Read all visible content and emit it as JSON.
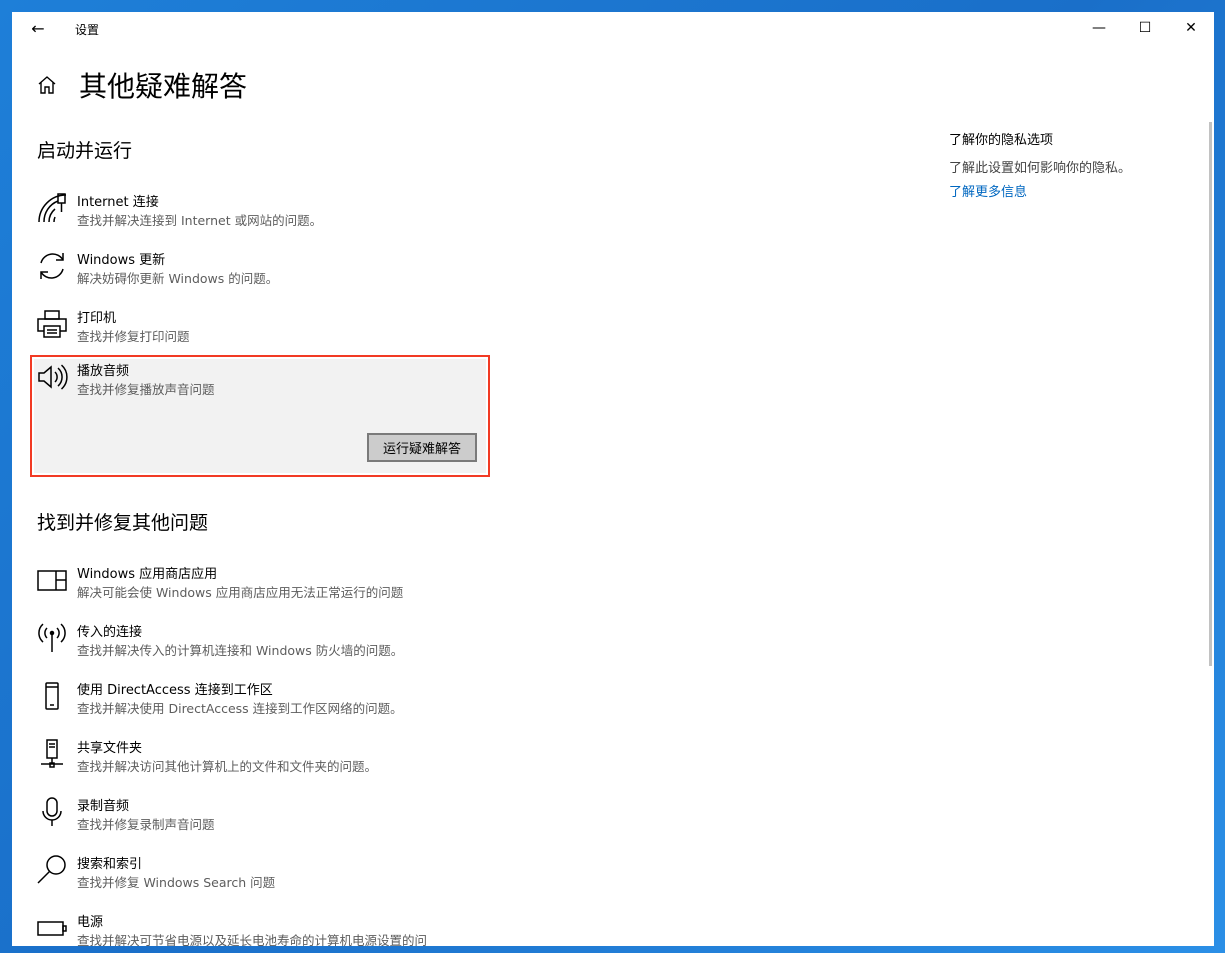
{
  "window": {
    "title": "设置",
    "back_icon": "←",
    "min_icon": "—",
    "max_icon": "☐",
    "close_icon": "✕"
  },
  "page": {
    "title": "其他疑难解答"
  },
  "sections": {
    "startup": {
      "title": "启动并运行",
      "items": [
        {
          "label": "Internet 连接",
          "desc": "查找并解决连接到 Internet 或网站的问题。",
          "icon": "wifi-icon"
        },
        {
          "label": "Windows 更新",
          "desc": "解决妨碍你更新 Windows 的问题。",
          "icon": "refresh-icon"
        },
        {
          "label": "打印机",
          "desc": "查找并修复打印问题",
          "icon": "printer-icon"
        },
        {
          "label": "播放音频",
          "desc": "查找并修复播放声音问题",
          "icon": "speaker-icon",
          "button": "运行疑难解答"
        }
      ]
    },
    "other": {
      "title": "找到并修复其他问题",
      "items": [
        {
          "label": "Windows 应用商店应用",
          "desc": "解决可能会使 Windows 应用商店应用无法正常运行的问题",
          "icon": "app-window-icon"
        },
        {
          "label": "传入的连接",
          "desc": "查找并解决传入的计算机连接和 Windows 防火墙的问题。",
          "icon": "antenna-icon"
        },
        {
          "label": "使用 DirectAccess 连接到工作区",
          "desc": "查找并解决使用 DirectAccess 连接到工作区网络的问题。",
          "icon": "phone-icon"
        },
        {
          "label": "共享文件夹",
          "desc": "查找并解决访问其他计算机上的文件和文件夹的问题。",
          "icon": "network-drive-icon"
        },
        {
          "label": "录制音频",
          "desc": "查找并修复录制声音问题",
          "icon": "microphone-icon"
        },
        {
          "label": "搜索和索引",
          "desc": "查找并修复 Windows Search 问题",
          "icon": "search-icon"
        },
        {
          "label": "电源",
          "desc": "查找并解决可节省电源以及延长电池寿命的计算机电源设置的问",
          "icon": "battery-icon"
        }
      ]
    }
  },
  "sidebar": {
    "title": "了解你的隐私选项",
    "desc": "了解此设置如何影响你的隐私。",
    "link": "了解更多信息"
  },
  "colors": {
    "accent": "#0067c0",
    "highlight_border": "#f23a24",
    "selected_bg": "#f2f2f2"
  }
}
